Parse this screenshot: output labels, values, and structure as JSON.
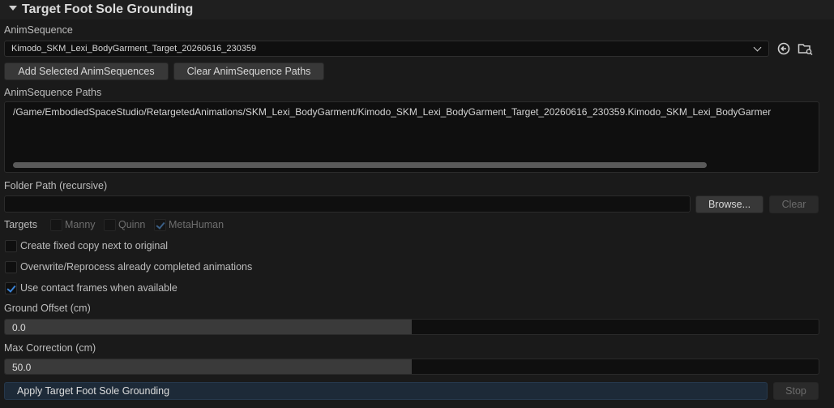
{
  "section": {
    "title": "Target Foot Sole Grounding"
  },
  "anim_sequence": {
    "label": "AnimSequence",
    "selected": "Kimodo_SKM_Lexi_BodyGarment_Target_20260616_230359",
    "icons": [
      "arrow-left-circle-icon",
      "browse-folder-icon"
    ]
  },
  "buttons": {
    "add_selected": "Add Selected AnimSequences",
    "clear_paths": "Clear AnimSequence Paths"
  },
  "paths": {
    "label": "AnimSequence Paths",
    "items": [
      "/Game/EmbodiedSpaceStudio/RetargetedAnimations/SKM_Lexi_BodyGarment/Kimodo_SKM_Lexi_BodyGarment_Target_20260616_230359.Kimodo_SKM_Lexi_BodyGarmer"
    ]
  },
  "folder": {
    "label": "Folder Path (recursive)",
    "value": "",
    "browse_label": "Browse...",
    "clear_label": "Clear"
  },
  "targets": {
    "label": "Targets",
    "options": [
      {
        "label": "Manny",
        "checked": false
      },
      {
        "label": "Quinn",
        "checked": false
      },
      {
        "label": "MetaHuman",
        "checked": true
      }
    ]
  },
  "options": [
    {
      "label": "Create fixed copy next to original",
      "checked": false
    },
    {
      "label": "Overwrite/Reprocess already completed animations",
      "checked": false
    },
    {
      "label": "Use contact frames when available",
      "checked": true
    }
  ],
  "ground_offset": {
    "label": "Ground Offset (cm)",
    "value": "0.0",
    "fill_fraction": 0.5
  },
  "max_correction": {
    "label": "Max Correction (cm)",
    "value": "50.0",
    "fill_fraction": 0.5
  },
  "actions": {
    "apply_label": "Apply Target Foot Sole Grounding",
    "stop_label": "Stop"
  },
  "colors": {
    "background": "#1a1a1a",
    "accent": "#3b83d6",
    "apply_button": "#1d2a38"
  }
}
